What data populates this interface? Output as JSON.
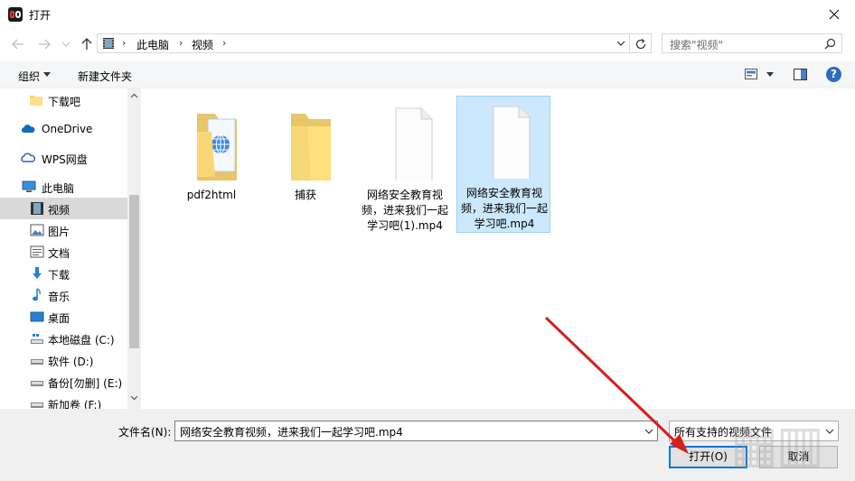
{
  "window": {
    "title": "打开"
  },
  "address": {
    "crumbs": [
      "此电脑",
      "视频"
    ]
  },
  "search": {
    "placeholder": "搜索\"视频\""
  },
  "toolbar": {
    "organize_label": "组织",
    "new_folder_label": "新建文件夹",
    "help_label": "?"
  },
  "sidebar": {
    "items": [
      {
        "label": "下载吧",
        "icon": "folder-icon"
      },
      {
        "label": "OneDrive",
        "icon": "cloud-icon"
      },
      {
        "label": "WPS网盘",
        "icon": "wps-cloud-icon"
      },
      {
        "label": "此电脑",
        "icon": "computer-icon"
      },
      {
        "label": "视频",
        "icon": "video-icon"
      },
      {
        "label": "图片",
        "icon": "pictures-icon"
      },
      {
        "label": "文档",
        "icon": "documents-icon"
      },
      {
        "label": "下载",
        "icon": "download-icon"
      },
      {
        "label": "音乐",
        "icon": "music-icon"
      },
      {
        "label": "桌面",
        "icon": "desktop-icon"
      },
      {
        "label": "本地磁盘 (C:)",
        "icon": "drive-icon"
      },
      {
        "label": "软件 (D:)",
        "icon": "drive-icon"
      },
      {
        "label": "备份[勿删] (E:)",
        "icon": "drive-icon"
      },
      {
        "label": "新加卷 (F:)",
        "icon": "drive-icon"
      }
    ],
    "selected_index": 4
  },
  "files": [
    {
      "name": "pdf2html",
      "icon": "folder-web-icon"
    },
    {
      "name": "捕获",
      "icon": "folder-icon"
    },
    {
      "name": "网络安全教育视频，进来我们一起学习吧(1).mp4",
      "icon": "file-icon"
    },
    {
      "name": "网络安全教育视频，进来我们一起学习吧.mp4",
      "icon": "file-icon",
      "selected": true
    }
  ],
  "bottom": {
    "filename_label": "文件名(N):",
    "filename_value": "网络安全教育视频，进来我们一起学习吧.mp4",
    "filetype_value": "所有支持的视频文件",
    "open_label": "打开(O)",
    "cancel_label": "取消"
  },
  "colors": {
    "accent": "#0078d7",
    "selection": "#cce8ff",
    "arrow": "#d42020"
  }
}
